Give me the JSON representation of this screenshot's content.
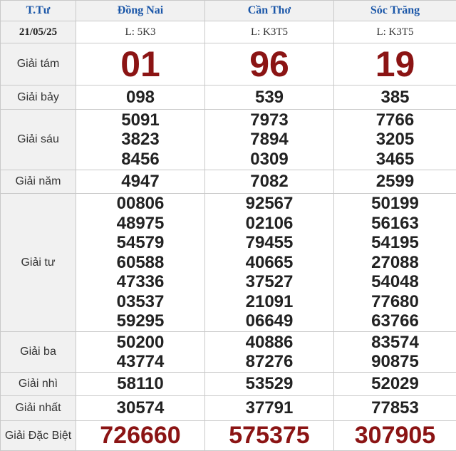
{
  "header": {
    "day": "T.Tư",
    "provinces": [
      "Đồng Nai",
      "Cần Thơ",
      "Sóc Trăng"
    ]
  },
  "series_row": {
    "date": "21/05/25",
    "codes": [
      "L: 5K3",
      "L: K3T5",
      "L: K3T5"
    ]
  },
  "prizes": {
    "g8": {
      "label": "Giải tám",
      "values": [
        "01",
        "96",
        "19"
      ]
    },
    "g7": {
      "label": "Giải bảy",
      "values": [
        "098",
        "539",
        "385"
      ]
    },
    "g6": {
      "label": "Giải sáu",
      "values": [
        [
          "5091",
          "3823",
          "8456"
        ],
        [
          "7973",
          "7894",
          "0309"
        ],
        [
          "7766",
          "3205",
          "3465"
        ]
      ]
    },
    "g5": {
      "label": "Giải năm",
      "values": [
        "4947",
        "7082",
        "2599"
      ]
    },
    "g4": {
      "label": "Giải tư",
      "values": [
        [
          "00806",
          "48975",
          "54579",
          "60588",
          "47336",
          "03537",
          "59295"
        ],
        [
          "92567",
          "02106",
          "79455",
          "40665",
          "37527",
          "21091",
          "06649"
        ],
        [
          "50199",
          "56163",
          "54195",
          "27088",
          "54048",
          "77680",
          "63766"
        ]
      ]
    },
    "g3": {
      "label": "Giải ba",
      "values": [
        [
          "50200",
          "43774"
        ],
        [
          "40886",
          "87276"
        ],
        [
          "83574",
          "90875"
        ]
      ]
    },
    "g2": {
      "label": "Giải nhì",
      "values": [
        "58110",
        "53529",
        "52029"
      ]
    },
    "g1": {
      "label": "Giải nhất",
      "values": [
        "30574",
        "37791",
        "77853"
      ]
    },
    "db": {
      "label": "Giải Đặc Biệt",
      "values": [
        "726660",
        "575375",
        "307905"
      ]
    }
  },
  "colors": {
    "header_text": "#1a56a8",
    "highlight_number": "#8b1414",
    "label_background": "#f1f1f1",
    "border": "#c9c9c9"
  }
}
